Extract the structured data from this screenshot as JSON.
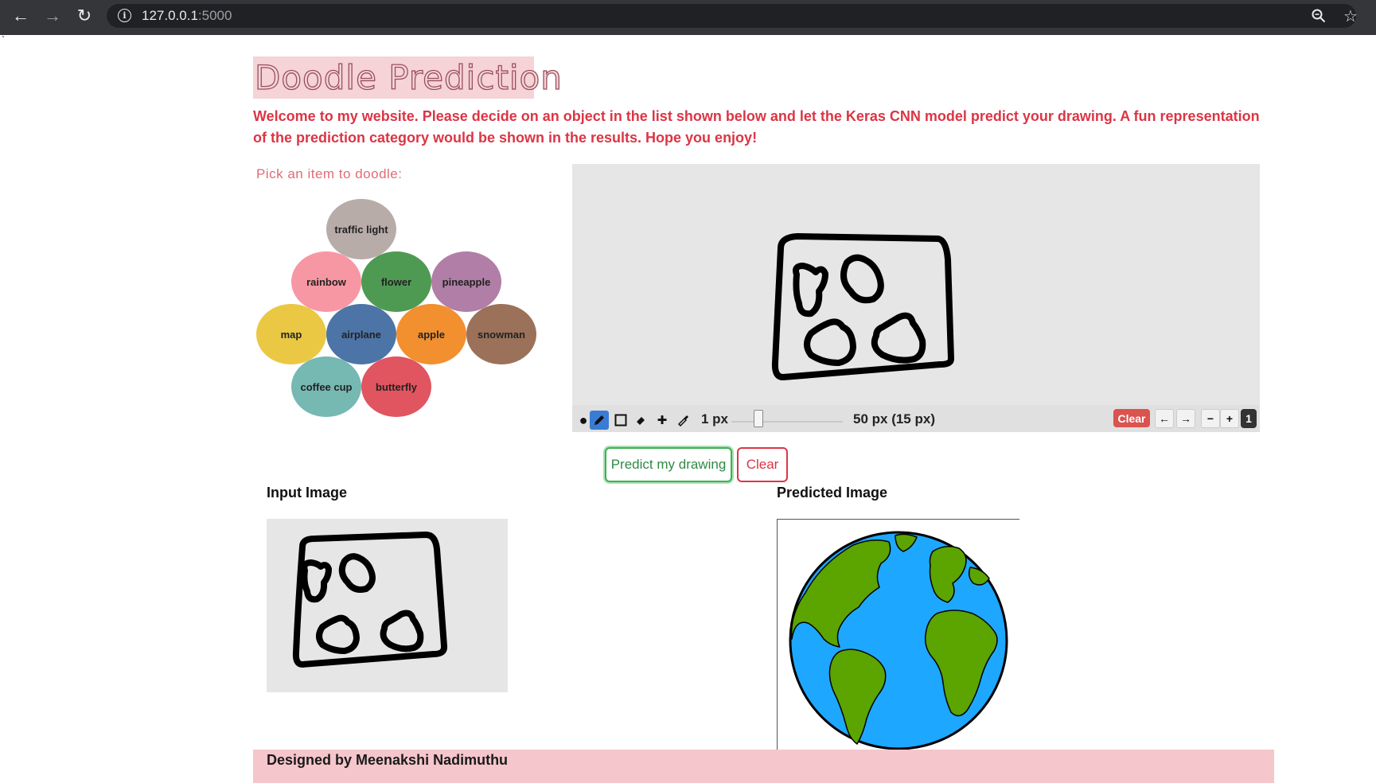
{
  "browser": {
    "url_host": "127.0.0.1",
    "url_port": ":5000"
  },
  "page": {
    "title": "Doodle Prediction",
    "intro": "Welcome to my website. Please decide on an object in the list shown below and let the Keras CNN model predict your drawing. A fun representation of the prediction category would be shown in the results. Hope you enjoy!",
    "pick_label": "Pick an item to doodle:",
    "items": [
      {
        "label": "traffic light",
        "color": "#b8aca9"
      },
      {
        "label": "rainbow",
        "color": "#f797a4"
      },
      {
        "label": "flower",
        "color": "#4f9a53"
      },
      {
        "label": "pineapple",
        "color": "#b07ea6"
      },
      {
        "label": "map",
        "color": "#eac843"
      },
      {
        "label": "airplane",
        "color": "#4d74a6"
      },
      {
        "label": "apple",
        "color": "#f28f2f"
      },
      {
        "label": "snowman",
        "color": "#9b715a"
      },
      {
        "label": "coffee cup",
        "color": "#76b8b2"
      },
      {
        "label": "butterfly",
        "color": "#e05560"
      }
    ]
  },
  "canvas_toolbar": {
    "line_width": "1 px",
    "brush_size": "50 px (15 px)",
    "clear_label": "Clear",
    "undo": "←",
    "redo": "→",
    "zoom_out": "−",
    "zoom_in": "+",
    "zoom_level": "1"
  },
  "actions": {
    "predict_label": "Predict my drawing",
    "clear_label": "Clear"
  },
  "results": {
    "input_heading": "Input Image",
    "predicted_heading": "Predicted Image"
  },
  "footer": {
    "credit": "Designed by Meenakshi Nadimuthu"
  }
}
